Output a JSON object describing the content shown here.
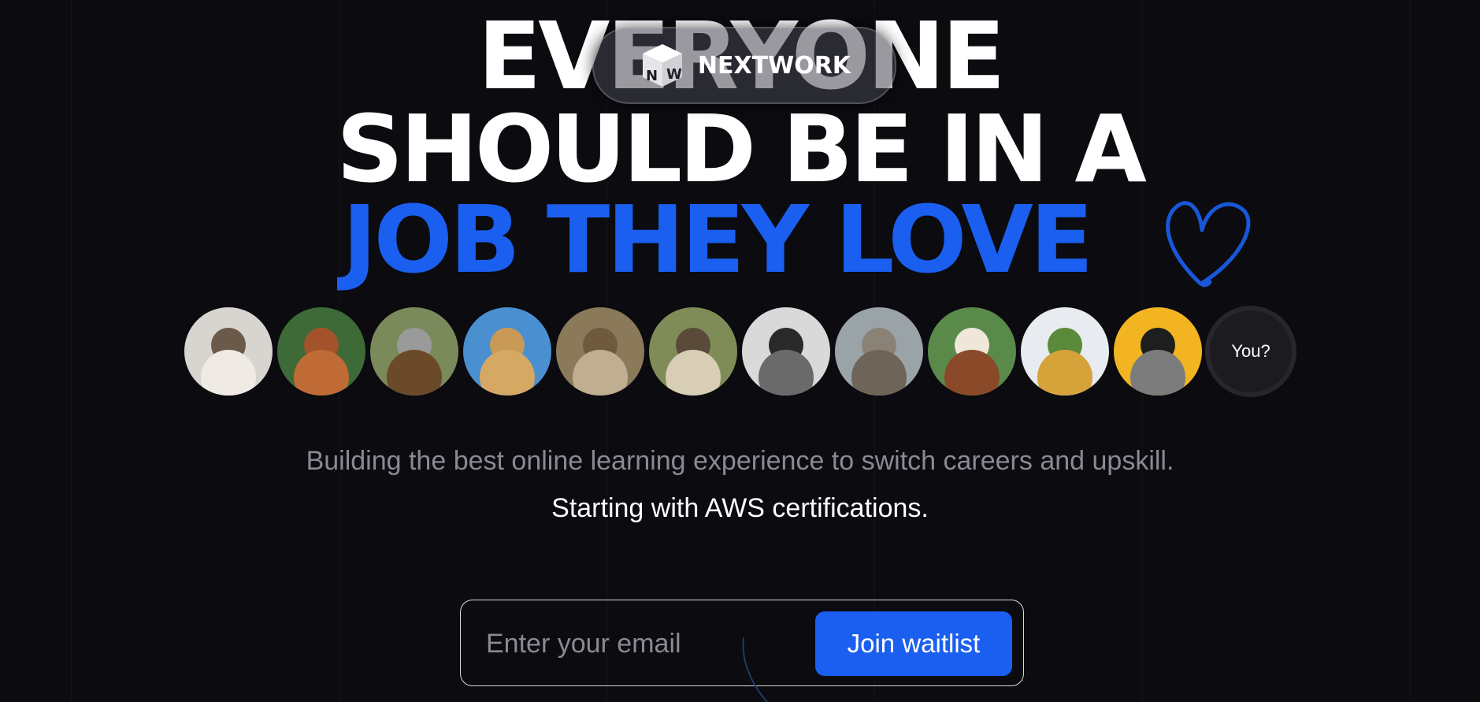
{
  "brand": {
    "name": "NEXTWORK",
    "logo_letters": [
      "N",
      "W"
    ]
  },
  "headline": {
    "line1": "EVERYONE",
    "line2": "SHOULD BE IN A",
    "line3": "JOB THEY LOVE"
  },
  "avatars": [
    {
      "icon": "pug-in-fluffy-hood",
      "bg": "#d8d4cf",
      "head": "#6b5a4a",
      "body": "#efeae3"
    },
    {
      "icon": "squirrel",
      "bg": "#3d6a36",
      "head": "#a3532a",
      "body": "#c06a36"
    },
    {
      "icon": "koala-on-branch",
      "bg": "#7a8a5a",
      "head": "#9a9a9a",
      "body": "#6b4a2a"
    },
    {
      "icon": "giraffe",
      "bg": "#4a8fd0",
      "head": "#c99a55",
      "body": "#d5a964"
    },
    {
      "icon": "kitten",
      "bg": "#8a7a5a",
      "head": "#6f5a3e",
      "body": "#bfae8f"
    },
    {
      "icon": "pug-in-blanket",
      "bg": "#7f8c58",
      "head": "#5a4a3a",
      "body": "#d8cdb5"
    },
    {
      "icon": "pug-with-glasses",
      "bg": "#d9d9d9",
      "head": "#2a2a2a",
      "body": "#6a6a6a"
    },
    {
      "icon": "seal",
      "bg": "#9aa3a8",
      "head": "#8a8276",
      "body": "#6e6558"
    },
    {
      "icon": "alpaca",
      "bg": "#5a8a4a",
      "head": "#efe7da",
      "body": "#8a4a2a"
    },
    {
      "icon": "pineapple-with-sunglasses",
      "bg": "#e8ebef",
      "head": "#5a8a3a",
      "body": "#d6a23a"
    },
    {
      "icon": "pug-in-sweater",
      "bg": "#f2b420",
      "head": "#1e1e1e",
      "body": "#7c7c7c"
    }
  ],
  "you_label": "You?",
  "subtitle": "Building the best online learning experience to switch careers and upskill.",
  "subtitle_secondary": "Starting with AWS certifications.",
  "form": {
    "email_placeholder": "Enter your email",
    "submit_label": "Join waitlist"
  },
  "colors": {
    "background": "#0b0b10",
    "accent": "#1a5ff0",
    "headline_white": "#ffffff",
    "muted_text": "#8a8a94"
  }
}
